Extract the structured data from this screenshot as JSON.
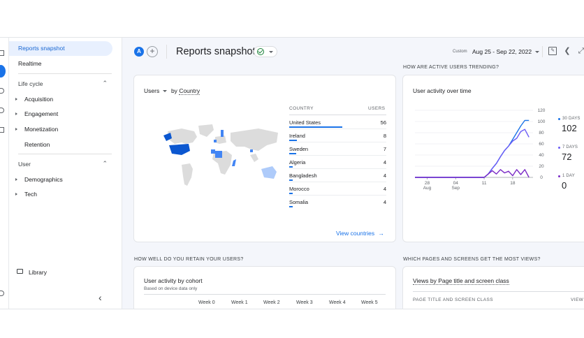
{
  "colors": {
    "accent": "#1a73e8",
    "map_dark": "#0b57d0",
    "map_mid": "#4285f4",
    "map_light": "#aecbfa",
    "seven_days": "#6b5cf6",
    "one_day": "#7b2cc6"
  },
  "sidebar": {
    "items": [
      {
        "label": "Reports snapshot"
      },
      {
        "label": "Realtime"
      }
    ],
    "lifecycle": {
      "label": "Life cycle",
      "items": [
        "Acquisition",
        "Engagement",
        "Monetization",
        "Retention"
      ]
    },
    "user": {
      "label": "User",
      "items": [
        "Demographics",
        "Tech"
      ]
    },
    "library": "Library"
  },
  "header": {
    "avatar_letter": "A",
    "add": "+",
    "title": "Reports snapshot",
    "custom_label": "Custom",
    "date_range": "Aug 25 - Sep 22, 2022"
  },
  "users_by_country": {
    "metric_label": "Users",
    "by_label": "by",
    "dimension_label": "Country",
    "col_country": "COUNTRY",
    "col_users": "USERS",
    "rows": [
      {
        "country": "United States",
        "users": "56",
        "share": 1.0
      },
      {
        "country": "Ireland",
        "users": "8",
        "share": 0.143
      },
      {
        "country": "Sweden",
        "users": "7",
        "share": 0.125
      },
      {
        "country": "Algeria",
        "users": "4",
        "share": 0.071
      },
      {
        "country": "Bangladesh",
        "users": "4",
        "share": 0.071
      },
      {
        "country": "Morocco",
        "users": "4",
        "share": 0.071
      },
      {
        "country": "Somalia",
        "users": "4",
        "share": 0.071
      }
    ],
    "view_link": "View countries"
  },
  "active_users": {
    "section": "HOW ARE ACTIVE USERS TRENDING?",
    "title": "User activity over time",
    "legend": [
      {
        "label": "30 DAYS",
        "value": "102",
        "color": "#1a73e8"
      },
      {
        "label": "7 DAYS",
        "value": "72",
        "color": "#6b5cf6"
      },
      {
        "label": "1 DAY",
        "value": "0",
        "color": "#7b2cc6"
      }
    ]
  },
  "chart_data": {
    "type": "line",
    "title": "User activity over time",
    "x_ticks": [
      {
        "day": 0,
        "line1": "28",
        "line2": "Aug"
      },
      {
        "day": 7,
        "line1": "04",
        "line2": "Sep"
      },
      {
        "day": 14,
        "line1": "11",
        "line2": ""
      },
      {
        "day": 21,
        "line1": "18",
        "line2": ""
      }
    ],
    "y_ticks": [
      0,
      20,
      40,
      60,
      80,
      100,
      120
    ],
    "ylim": [
      0,
      120
    ],
    "xlim": [
      -3,
      26
    ],
    "series": [
      {
        "name": "30 DAYS",
        "color": "#1a73e8",
        "x": [
          -3,
          -2,
          -1,
          0,
          1,
          2,
          3,
          4,
          5,
          6,
          7,
          8,
          9,
          10,
          11,
          12,
          13,
          14,
          15,
          16,
          17,
          18,
          19,
          20,
          21,
          22,
          23,
          24,
          25
        ],
        "values": [
          0,
          0,
          0,
          0,
          0,
          0,
          0,
          0,
          0,
          0,
          0,
          0,
          0,
          0,
          0,
          0,
          0,
          0,
          6,
          16,
          25,
          37,
          48,
          56,
          68,
          80,
          92,
          102,
          102
        ]
      },
      {
        "name": "7 DAYS",
        "color": "#6b5cf6",
        "x": [
          -3,
          -2,
          -1,
          0,
          1,
          2,
          3,
          4,
          5,
          6,
          7,
          8,
          9,
          10,
          11,
          12,
          13,
          14,
          15,
          16,
          17,
          18,
          19,
          20,
          21,
          22,
          23,
          24,
          25
        ],
        "values": [
          0,
          0,
          0,
          0,
          0,
          0,
          0,
          0,
          0,
          0,
          0,
          0,
          0,
          0,
          0,
          0,
          0,
          0,
          6,
          16,
          25,
          37,
          48,
          56,
          65,
          70,
          82,
          86,
          72
        ]
      },
      {
        "name": "1 DAY",
        "color": "#7b2cc6",
        "x": [
          -3,
          -2,
          -1,
          0,
          1,
          2,
          3,
          4,
          5,
          6,
          7,
          8,
          9,
          10,
          11,
          12,
          13,
          14,
          15,
          16,
          17,
          18,
          19,
          20,
          21,
          22,
          23,
          24,
          25
        ],
        "values": [
          0,
          0,
          0,
          0,
          0,
          0,
          0,
          0,
          0,
          0,
          0,
          0,
          0,
          0,
          0,
          0,
          0,
          0,
          6,
          12,
          6,
          14,
          8,
          11,
          3,
          14,
          5,
          14,
          0
        ]
      }
    ]
  },
  "retention": {
    "section": "HOW WELL DO YOU RETAIN YOUR USERS?",
    "title": "User activity by cohort",
    "subtitle": "Based on device data only",
    "weeks": [
      "Week 0",
      "Week 1",
      "Week 2",
      "Week 3",
      "Week 4",
      "Week 5"
    ]
  },
  "pages": {
    "section": "WHICH PAGES AND SCREENS GET THE MOST VIEWS?",
    "title": "Views by Page title and screen class",
    "col_page": "PAGE TITLE AND SCREEN CLASS",
    "col_views": "VIEW"
  }
}
